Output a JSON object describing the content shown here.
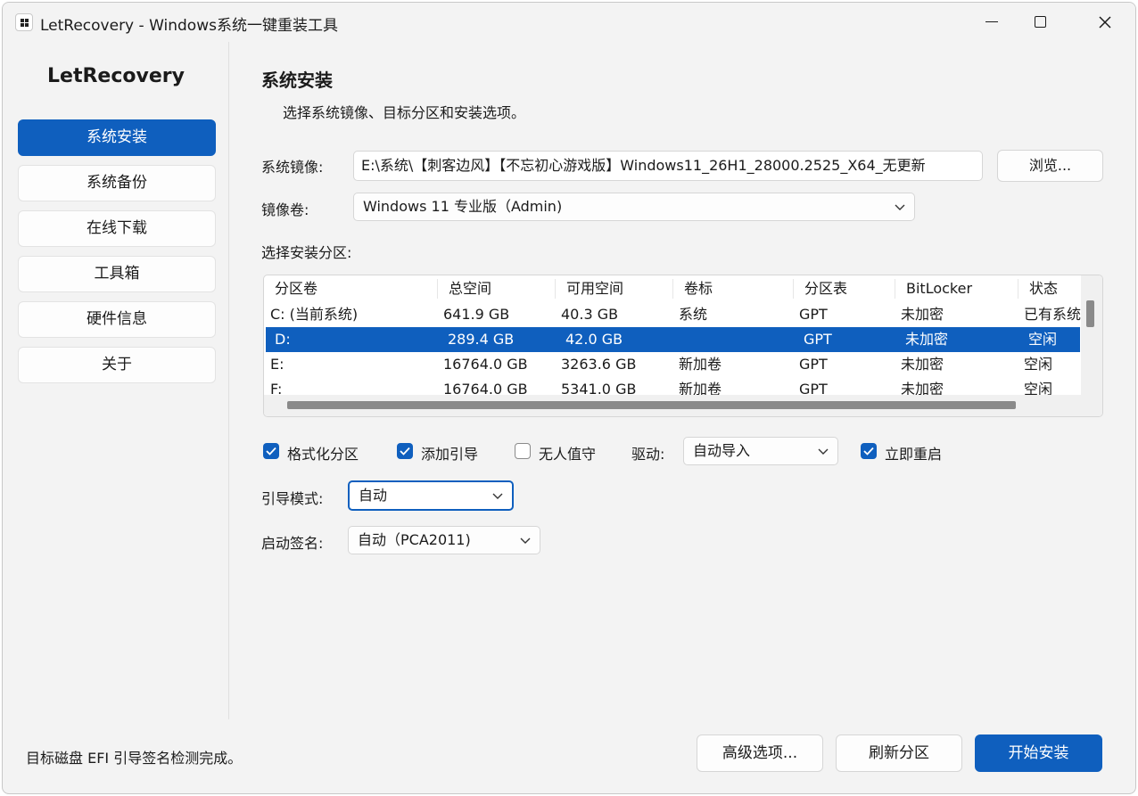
{
  "window": {
    "title": "LetRecovery - Windows系统一键重装工具"
  },
  "sidebar": {
    "brand": "LetRecovery",
    "items": [
      {
        "label": "系统安装",
        "active": true
      },
      {
        "label": "系统备份"
      },
      {
        "label": "在线下载"
      },
      {
        "label": "工具箱"
      },
      {
        "label": "硬件信息"
      },
      {
        "label": "关于"
      }
    ]
  },
  "main": {
    "title": "系统安装",
    "subtitle": "选择系统镜像、目标分区和安装选项。",
    "image_label": "系统镜像:",
    "image_path": "E:\\系统\\【刺客边风】【不忘初心游戏版】Windows11_26H1_28000.2525_X64_无更新",
    "browse_label": "浏览...",
    "volume_label": "镜像卷:",
    "volume_value": "Windows 11 专业版（Admin)",
    "partition_label": "选择安装分区:",
    "partition_table": {
      "columns": [
        "分区卷",
        "总空间",
        "可用空间",
        "卷标",
        "分区表",
        "BitLocker",
        "状态"
      ],
      "rows": [
        [
          "C: (当前系统)",
          "641.9 GB",
          "40.3 GB",
          "系统",
          "GPT",
          "未加密",
          "已有系统"
        ],
        [
          "D:",
          "289.4 GB",
          "42.0 GB",
          "",
          "GPT",
          "未加密",
          "空闲"
        ],
        [
          "E:",
          "16764.0 GB",
          "3263.6 GB",
          "新加卷",
          "GPT",
          "未加密",
          "空闲"
        ],
        [
          "F:",
          "16764.0 GB",
          "5341.0 GB",
          "新加卷",
          "GPT",
          "未加密",
          "空闲"
        ]
      ],
      "selected_row": 1
    },
    "options": {
      "format_label": "格式化分区",
      "format_checked": true,
      "boot_label": "添加引导",
      "boot_checked": true,
      "unattended_label": "无人值守",
      "unattended_checked": false,
      "driver_label": "驱动:",
      "driver_value": "自动导入",
      "reboot_label": "立即重启",
      "reboot_checked": true
    },
    "boot_mode_label": "引导模式:",
    "boot_mode_value": "自动",
    "signature_label": "启动签名:",
    "signature_value": "自动（PCA2011)"
  },
  "footer": {
    "status": "目标磁盘 EFI 引导签名检测完成。",
    "advanced_label": "高级选项...",
    "refresh_label": "刷新分区",
    "install_label": "开始安装"
  },
  "colors": {
    "accent": "#0f5fbe",
    "background": "#f3f3f3"
  }
}
